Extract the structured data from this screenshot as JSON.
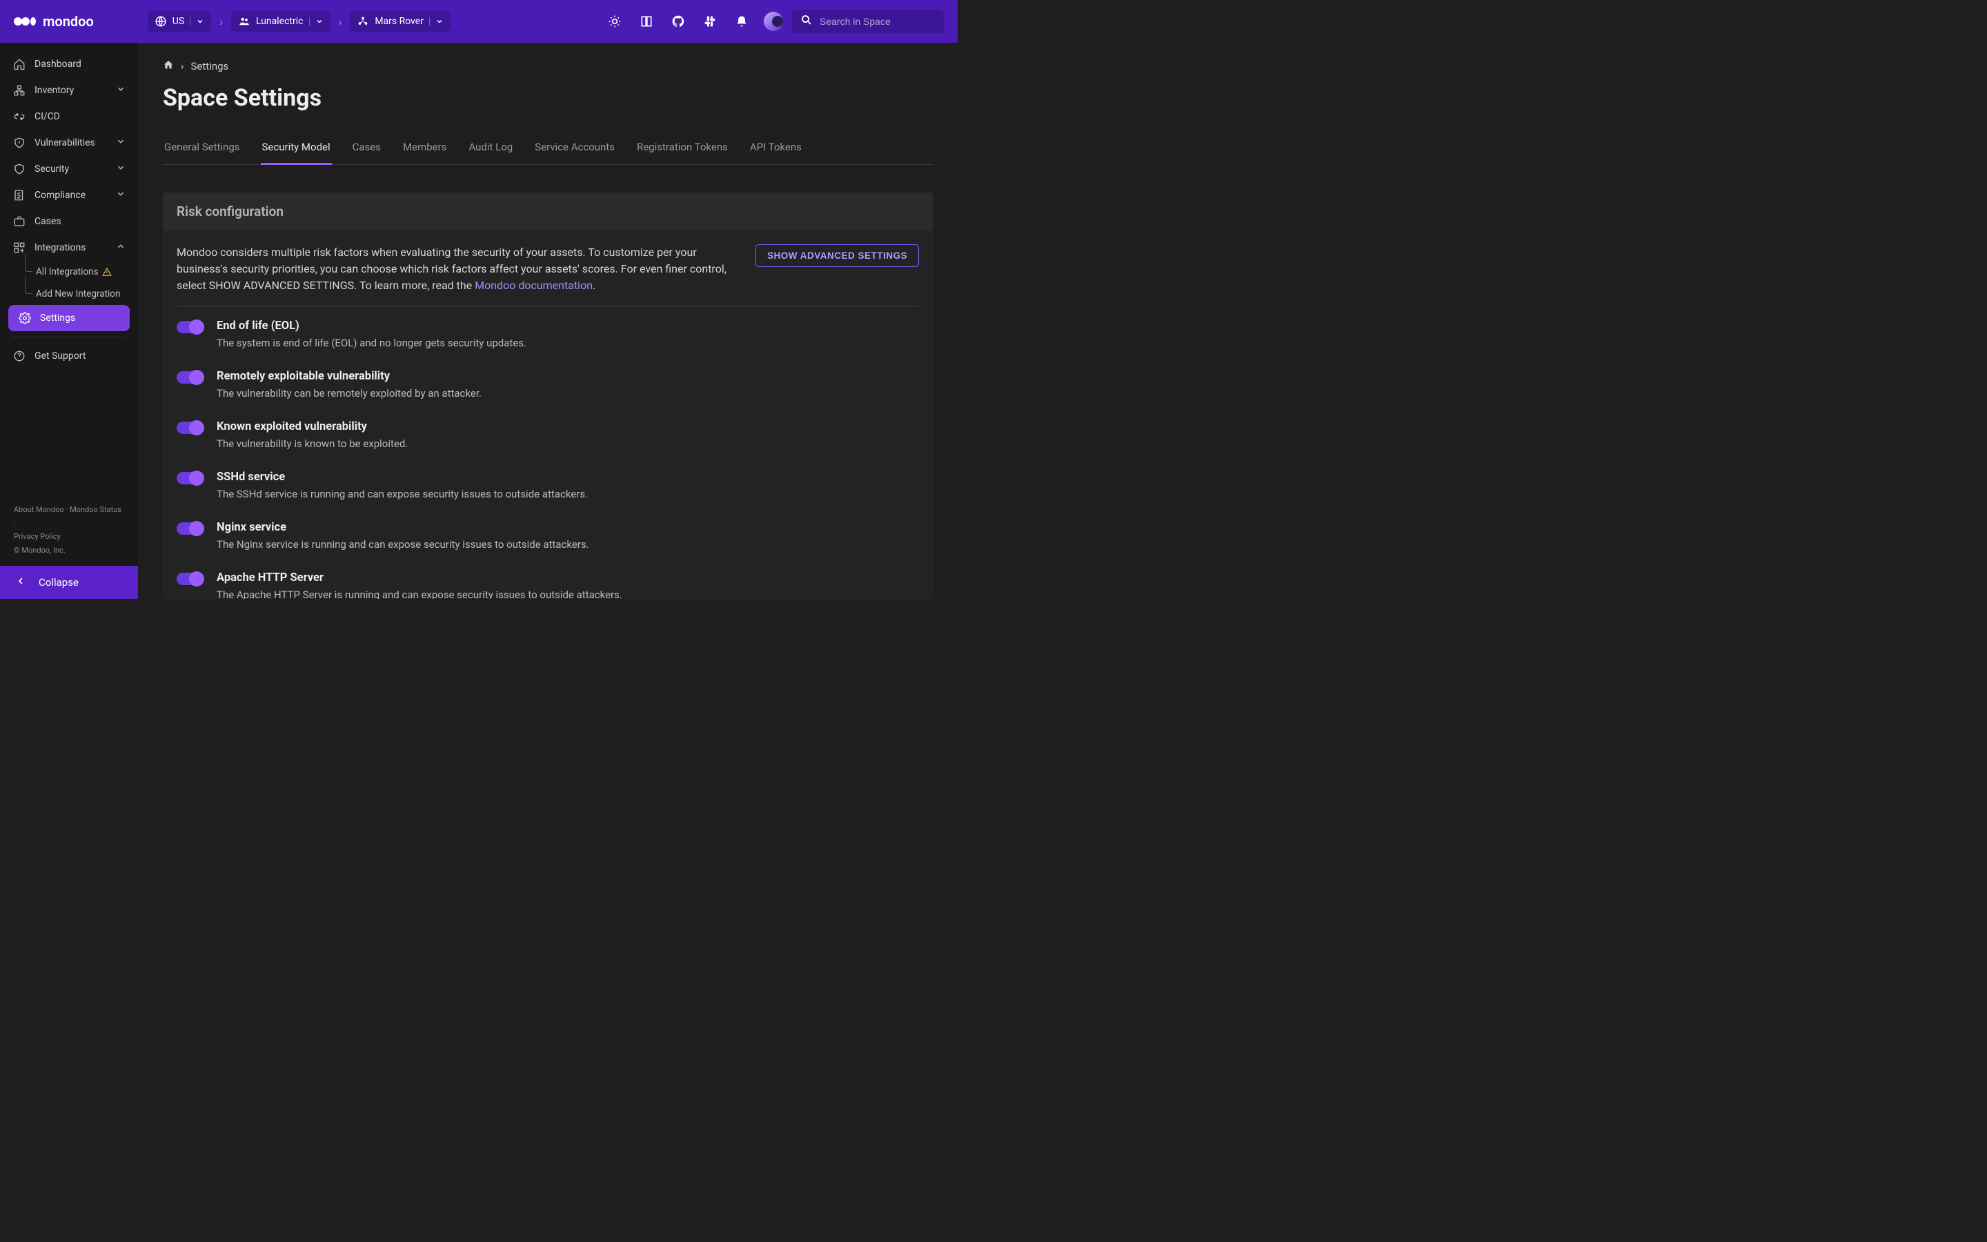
{
  "brand": "mondoo",
  "header": {
    "crumbs": [
      {
        "label": "US"
      },
      {
        "label": "Lunalectric"
      },
      {
        "label": "Mars Rover"
      }
    ],
    "search_placeholder": "Search in Space"
  },
  "sidebar": {
    "items": [
      {
        "label": "Dashboard"
      },
      {
        "label": "Inventory",
        "expandable": true
      },
      {
        "label": "CI/CD"
      },
      {
        "label": "Vulnerabilities",
        "expandable": true
      },
      {
        "label": "Security",
        "expandable": true
      },
      {
        "label": "Compliance",
        "expandable": true
      },
      {
        "label": "Cases"
      },
      {
        "label": "Integrations",
        "expandable": true,
        "expanded": true
      },
      {
        "label": "Settings",
        "active": true
      }
    ],
    "integrations_sub": [
      {
        "label": "All Integrations",
        "warn": true
      },
      {
        "label": "Add New Integration"
      }
    ],
    "support_label": "Get Support",
    "footer_links": [
      "About Mondoo",
      "Mondoo Status",
      "Privacy Policy"
    ],
    "copyright": "© Mondoo, Inc.",
    "collapse_label": "Collapse"
  },
  "breadcrumb": {
    "current": "Settings"
  },
  "page_title": "Space Settings",
  "tabs": [
    {
      "label": "General Settings"
    },
    {
      "label": "Security Model",
      "active": true
    },
    {
      "label": "Cases"
    },
    {
      "label": "Members"
    },
    {
      "label": "Audit Log"
    },
    {
      "label": "Service Accounts"
    },
    {
      "label": "Registration Tokens"
    },
    {
      "label": "API Tokens"
    }
  ],
  "risk_panel": {
    "title": "Risk configuration",
    "description_pre": "Mondoo considers multiple risk factors when evaluating the security of your assets. To customize per your business's security priorities, you can choose which risk factors affect your assets' scores. For even finer control, select SHOW ADVANCED SETTINGS. To learn more, read the ",
    "doc_link_text": "Mondoo documentation",
    "description_post": ".",
    "advanced_button": "SHOW ADVANCED SETTINGS",
    "items": [
      {
        "title": "End of life (EOL)",
        "desc": "The system is end of life (EOL) and no longer gets security updates.",
        "enabled": true
      },
      {
        "title": "Remotely exploitable vulnerability",
        "desc": "The vulnerability can be remotely exploited by an attacker.",
        "enabled": true
      },
      {
        "title": "Known exploited vulnerability",
        "desc": "The vulnerability is known to be exploited.",
        "enabled": true
      },
      {
        "title": "SSHd service",
        "desc": "The SSHd service is running and can expose security issues to outside attackers.",
        "enabled": true
      },
      {
        "title": "Nginx service",
        "desc": "The Nginx service is running and can expose security issues to outside attackers.",
        "enabled": true
      },
      {
        "title": "Apache HTTP Server",
        "desc": "The Apache HTTP Server is running and can expose security issues to outside attackers.",
        "enabled": true
      }
    ]
  }
}
